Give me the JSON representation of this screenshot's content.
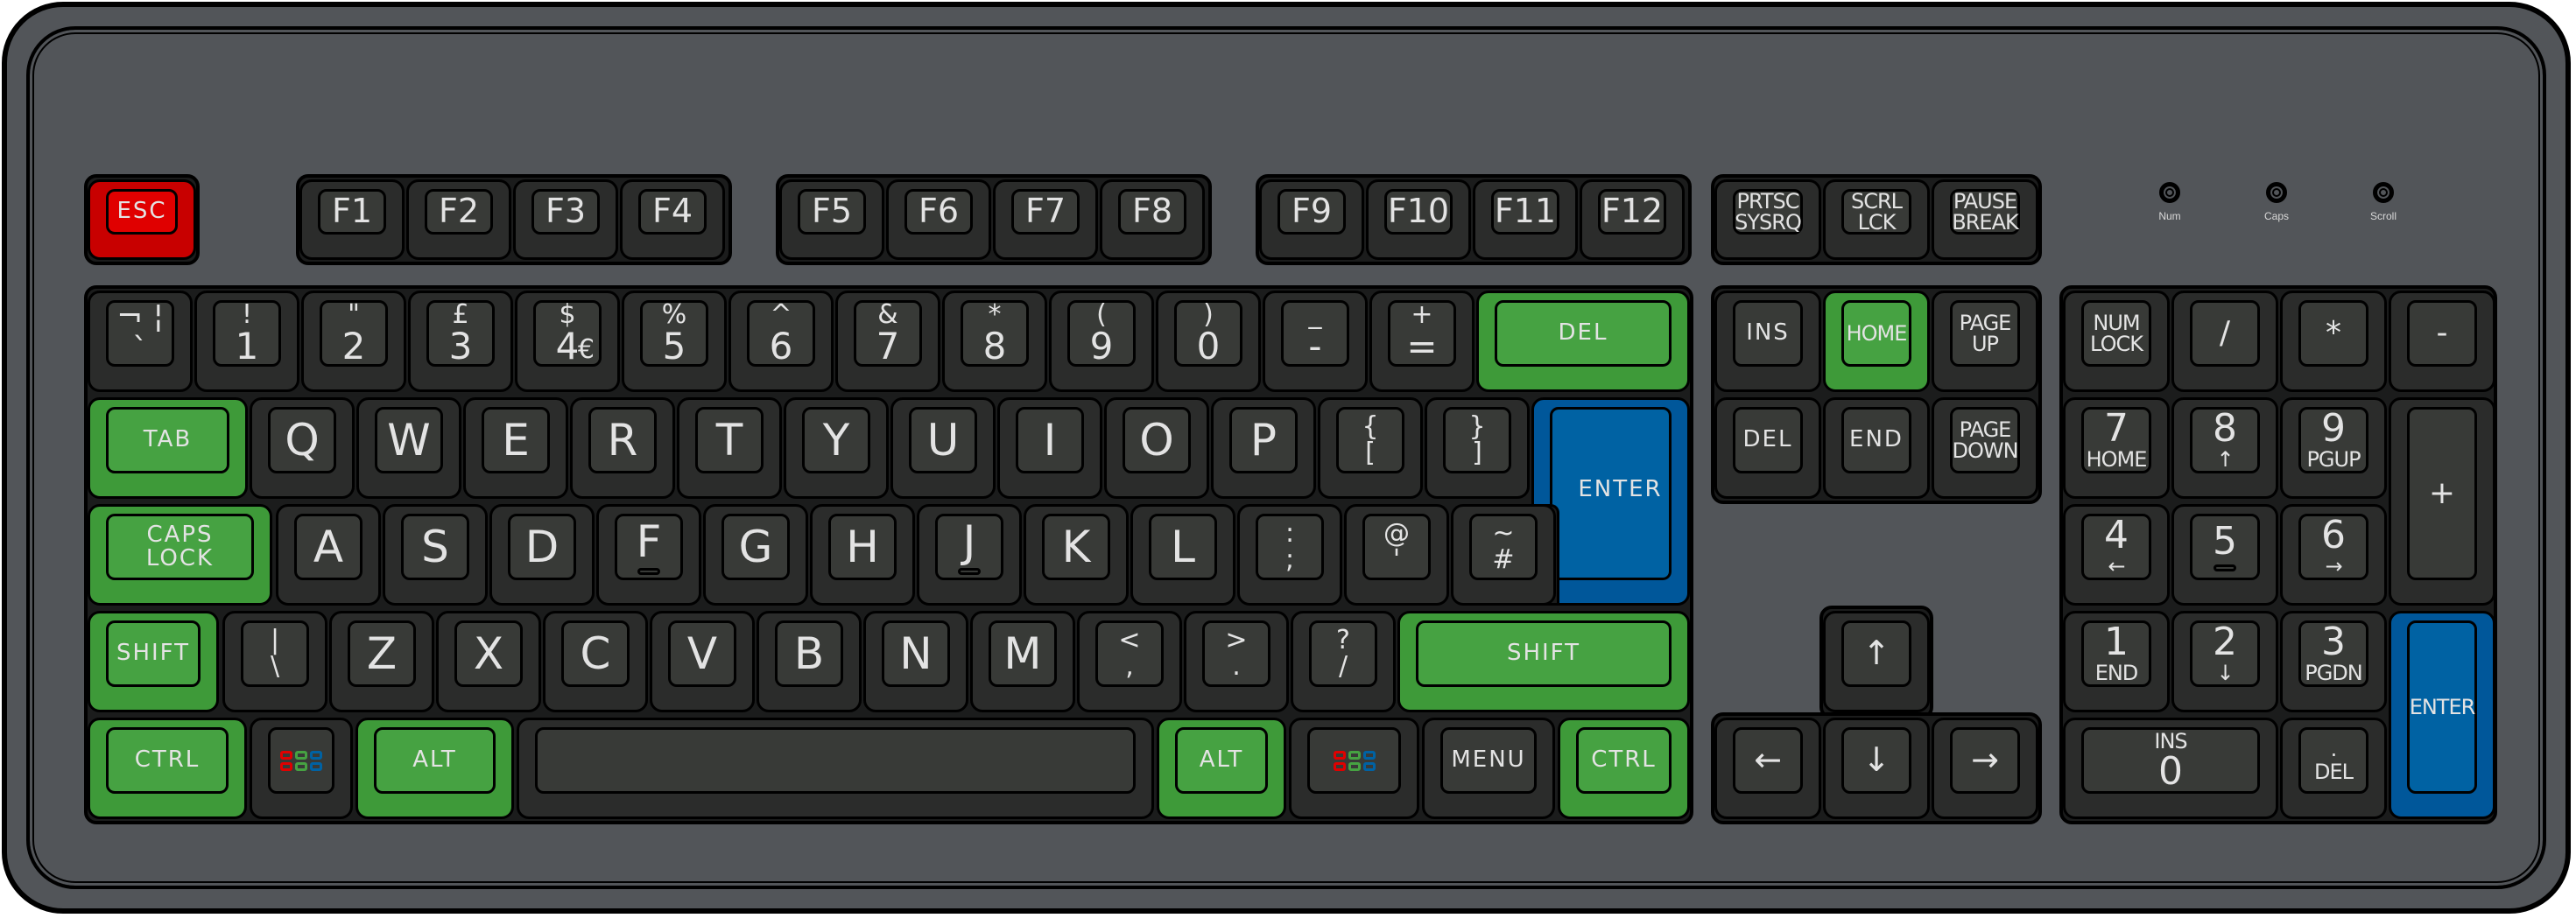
{
  "keyboard": {
    "layout": "UK ISO",
    "colors": {
      "case": "#525559",
      "key_default": "#383a37",
      "key_modifier": "#46a242",
      "key_enter": "#0062a3",
      "key_escape": "#e00000",
      "legend": "#e3e3e3",
      "win_logo": [
        "#e00000",
        "#46a242",
        "#0062a3"
      ]
    },
    "leds": [
      {
        "label": "Num"
      },
      {
        "label": "Caps"
      },
      {
        "label": "Scroll"
      }
    ],
    "function_row": {
      "esc": "ESC",
      "f1_f4": [
        "F1",
        "F2",
        "F3",
        "F4"
      ],
      "f5_f8": [
        "F5",
        "F6",
        "F7",
        "F8"
      ],
      "f9_f12": [
        "F9",
        "F10",
        "F11",
        "F12"
      ],
      "system": [
        {
          "top": "PRTSC",
          "bottom": "SYSRQ"
        },
        {
          "top": "SCRL",
          "bottom": "LCK"
        },
        {
          "top": "PAUSE",
          "bottom": "BREAK"
        }
      ]
    },
    "number_row": [
      {
        "top": "¬",
        "bottom": "`",
        "alt": "¦"
      },
      {
        "top": "!",
        "bottom": "1"
      },
      {
        "top": "\"",
        "bottom": "2"
      },
      {
        "top": "£",
        "bottom": "3"
      },
      {
        "top": "$",
        "bottom": "4",
        "alt": "€"
      },
      {
        "top": "%",
        "bottom": "5"
      },
      {
        "top": "^",
        "bottom": "6"
      },
      {
        "top": "&",
        "bottom": "7"
      },
      {
        "top": "*",
        "bottom": "8"
      },
      {
        "top": "(",
        "bottom": "9"
      },
      {
        "top": ")",
        "bottom": "0"
      },
      {
        "top": "_",
        "bottom": "-"
      },
      {
        "top": "+",
        "bottom": "="
      }
    ],
    "backspace": "DEL",
    "tab": "TAB",
    "qwerty_row": [
      "Q",
      "W",
      "E",
      "R",
      "T",
      "Y",
      "U",
      "I",
      "O",
      "P"
    ],
    "brackets": [
      {
        "top": "{",
        "bottom": "["
      },
      {
        "top": "}",
        "bottom": "]"
      }
    ],
    "enter": "ENTER",
    "caps": {
      "top": "CAPS",
      "bottom": "LOCK"
    },
    "home_row": [
      "A",
      "S",
      "D",
      "F",
      "G",
      "H",
      "J",
      "K",
      "L"
    ],
    "home_row_symbols": [
      {
        "top": ":",
        "bottom": ";"
      },
      {
        "top": "@",
        "bottom": "'"
      },
      {
        "top": "~",
        "bottom": "#"
      }
    ],
    "left_shift": "SHIFT",
    "backslash": {
      "top": "|",
      "bottom": "\\"
    },
    "bottom_letters": [
      "Z",
      "X",
      "C",
      "V",
      "B",
      "N",
      "M"
    ],
    "bottom_symbols": [
      {
        "top": "<",
        "bottom": ","
      },
      {
        "top": ">",
        "bottom": "."
      },
      {
        "top": "?",
        "bottom": "/"
      }
    ],
    "right_shift": "SHIFT",
    "bottom_row": {
      "left_ctrl": "CTRL",
      "left_alt": "ALT",
      "space": "",
      "right_alt": "ALT",
      "menu": "MENU",
      "right_ctrl": "CTRL"
    },
    "nav_cluster": [
      [
        "INS",
        "HOME",
        "PAGE UP"
      ],
      [
        "DEL",
        "END",
        "PAGE DOWN"
      ]
    ],
    "nav_labels": {
      "ins": "INS",
      "home": "HOME",
      "pgup_top": "PAGE",
      "pgup_bottom": "UP",
      "del": "DEL",
      "end": "END",
      "pgdn_top": "PAGE",
      "pgdn_bottom": "DOWN"
    },
    "arrows": {
      "up": "↑",
      "left": "←",
      "down": "↓",
      "right": "→"
    },
    "numpad": {
      "numlock": {
        "top": "NUM",
        "bottom": "LOCK"
      },
      "divide": "/",
      "multiply": "*",
      "minus": "-",
      "plus": "+",
      "enter": "ENTER",
      "keys": [
        {
          "top": "7",
          "bottom": "HOME"
        },
        {
          "top": "8",
          "bottom": "↑"
        },
        {
          "top": "9",
          "bottom": "PGUP"
        },
        {
          "top": "4",
          "bottom": "←"
        },
        {
          "top": "5",
          "bottom": ""
        },
        {
          "top": "6",
          "bottom": "→"
        },
        {
          "top": "1",
          "bottom": "END"
        },
        {
          "top": "2",
          "bottom": "↓"
        },
        {
          "top": "3",
          "bottom": "PGDN"
        }
      ],
      "zero": {
        "top": "INS",
        "bottom": "0"
      },
      "decimal": {
        "top": ".",
        "bottom": "DEL"
      }
    }
  }
}
